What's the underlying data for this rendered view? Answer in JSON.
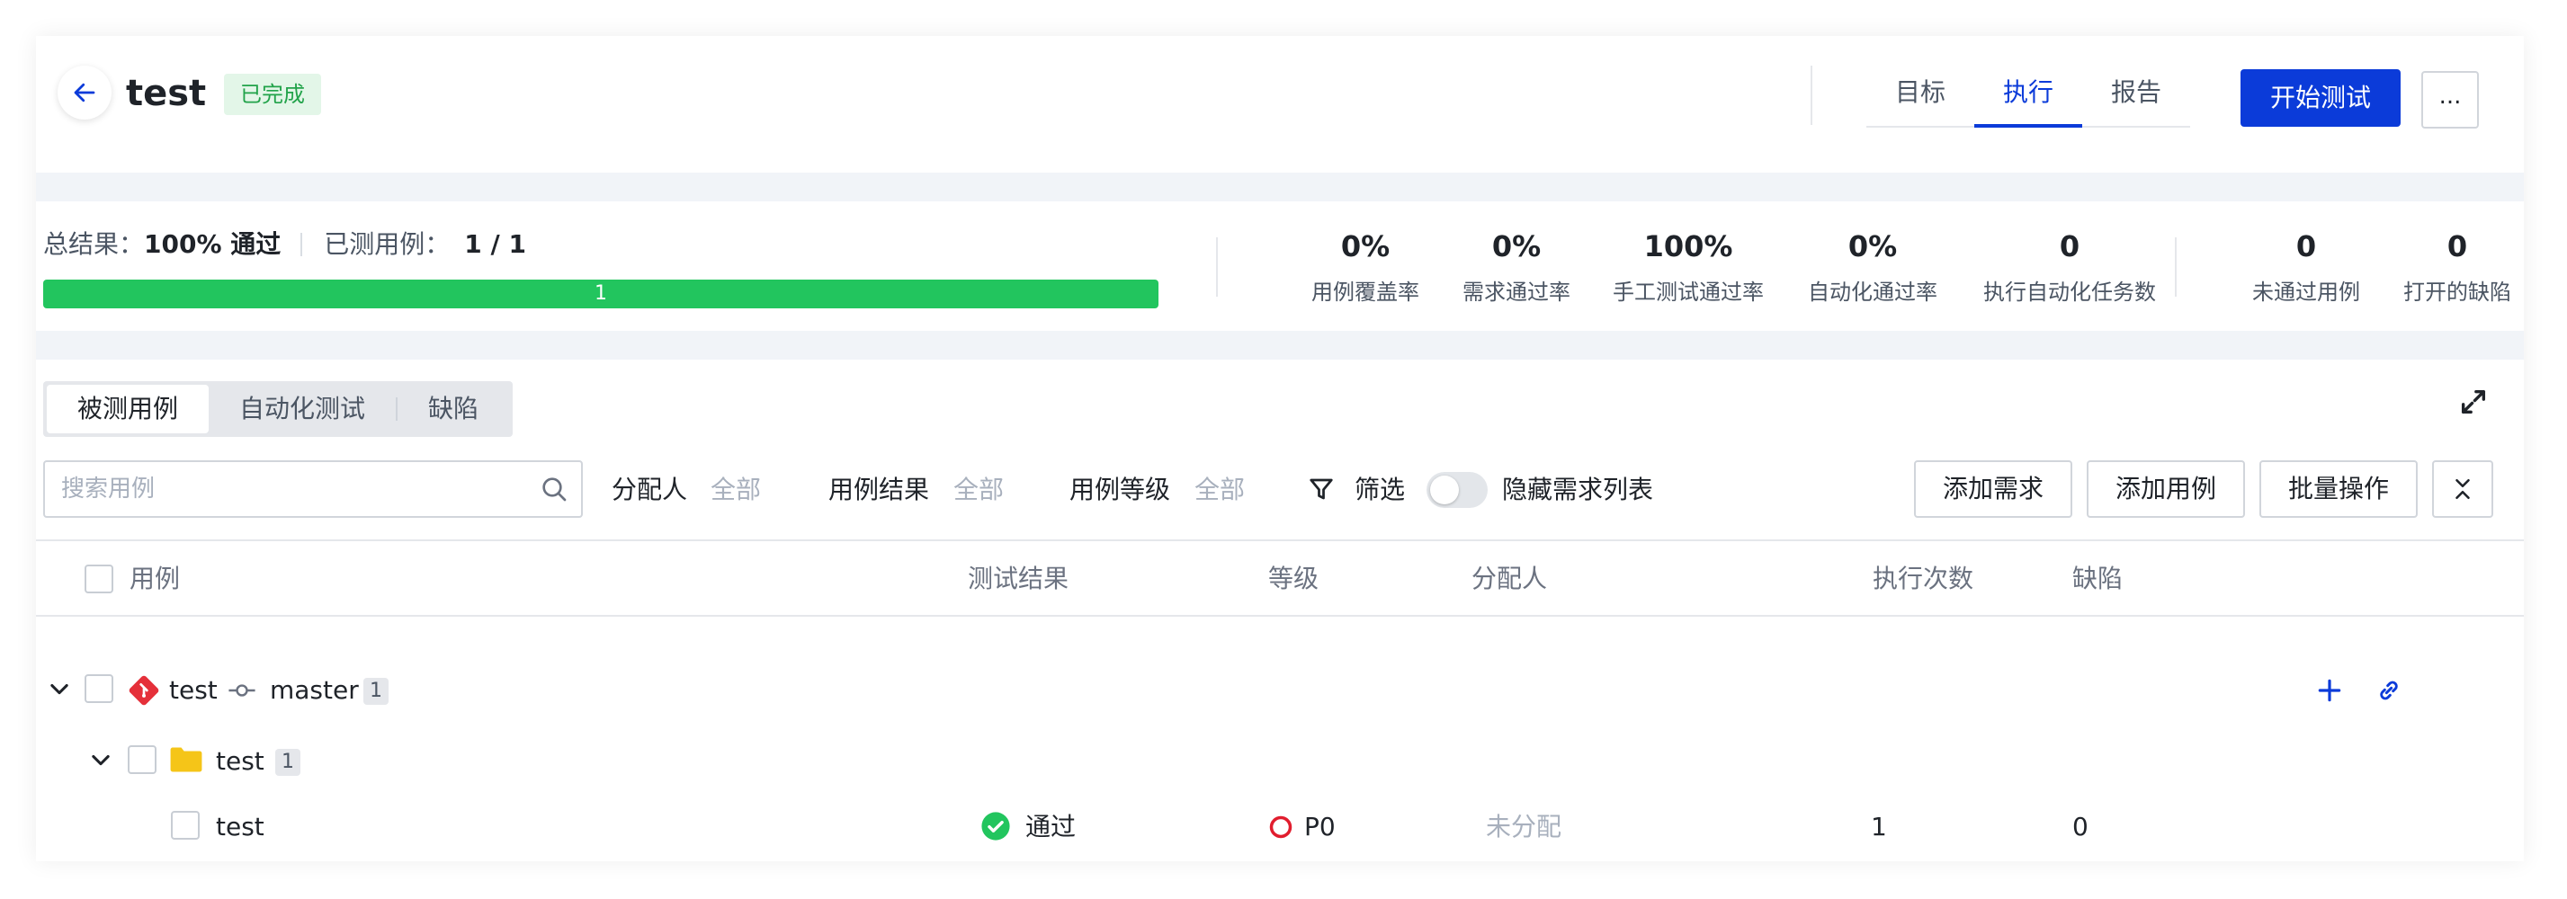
{
  "header": {
    "title": "test",
    "status": "已完成",
    "tabs": [
      {
        "label": "目标",
        "active": false
      },
      {
        "label": "执行",
        "active": true
      },
      {
        "label": "报告",
        "active": false
      }
    ],
    "start_button": "开始测试",
    "more_button": "..."
  },
  "summary": {
    "total_result_label": "总结果：",
    "total_result_value": "100% 通过",
    "tested_label": "已测用例：",
    "tested_value": "1 / 1",
    "progress_label": "1",
    "progress_fraction": 1.0,
    "progress_color": "#22c55e"
  },
  "stats": [
    {
      "value": "0%",
      "label": "用例覆盖率"
    },
    {
      "value": "0%",
      "label": "需求通过率"
    },
    {
      "value": "100%",
      "label": "手工测试通过率"
    },
    {
      "value": "0%",
      "label": "自动化通过率"
    },
    {
      "value": "0",
      "label": "执行自动化任务数"
    },
    {
      "value": "0",
      "label": "未通过用例"
    },
    {
      "value": "0",
      "label": "打开的缺陷"
    }
  ],
  "segments": [
    {
      "label": "被测用例",
      "active": true
    },
    {
      "label": "自动化测试",
      "active": false
    },
    {
      "label": "缺陷",
      "active": false
    }
  ],
  "filters": {
    "search_placeholder": "搜索用例",
    "assignee_label": "分配人",
    "assignee_value": "全部",
    "result_label": "用例结果",
    "result_value": "全部",
    "level_label": "用例等级",
    "level_value": "全部",
    "filter_label": "筛选",
    "hide_req_label": "隐藏需求列表",
    "hide_req_on": false
  },
  "actions": {
    "add_requirement": "添加需求",
    "add_case": "添加用例",
    "batch": "批量操作"
  },
  "table": {
    "columns": [
      "用例",
      "测试结果",
      "等级",
      "分配人",
      "执行次数",
      "缺陷"
    ],
    "repo_row": {
      "name": "test",
      "branch": "master",
      "count": "1"
    },
    "folder_row": {
      "name": "test",
      "count": "1"
    },
    "case_row": {
      "name": "test",
      "result": "通过",
      "level": "P0",
      "assignee": "未分配",
      "runs": "1",
      "defects": "0"
    }
  },
  "colors": {
    "accent": "#0b3bd9",
    "pass": "#22c55e",
    "p0": "#e11d2e",
    "folder": "#f5c518",
    "git": "#e5303a"
  }
}
